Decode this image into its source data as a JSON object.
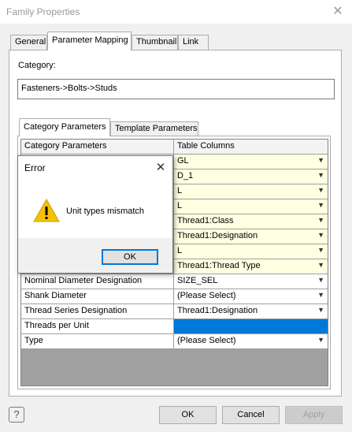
{
  "window": {
    "title": "Family Properties"
  },
  "tabs": [
    {
      "label": "General"
    },
    {
      "label": "Parameter Mapping"
    },
    {
      "label": "Thumbnail"
    },
    {
      "label": "Link"
    }
  ],
  "category": {
    "label": "Category:",
    "value": "Fasteners->Bolts->Studs"
  },
  "subtabs": [
    {
      "label": "Category Parameters"
    },
    {
      "label": "Template Parameters"
    }
  ],
  "grid": {
    "headers": [
      "Category Parameters",
      "Table Columns"
    ],
    "rows": [
      {
        "name": "",
        "column": "GL"
      },
      {
        "name": "",
        "column": "D_1"
      },
      {
        "name": "",
        "column": "L"
      },
      {
        "name": "",
        "column": "L"
      },
      {
        "name": "",
        "column": "Thread1:Class"
      },
      {
        "name": "",
        "column": "Thread1:Designation"
      },
      {
        "name": "",
        "column": "L"
      },
      {
        "name": "",
        "column": "Thread1:Thread Type"
      },
      {
        "name": "Nominal Diameter Designation",
        "column": "SIZE_SEL"
      },
      {
        "name": "Shank Diameter",
        "column": "(Please Select)"
      },
      {
        "name": "Thread Series Designation",
        "column": "Thread1:Designation"
      },
      {
        "name": "Threads per Unit",
        "column": ""
      },
      {
        "name": "Type",
        "column": "(Please Select)"
      }
    ]
  },
  "buttons": {
    "ok": "OK",
    "cancel": "Cancel",
    "apply": "Apply",
    "help": "?"
  },
  "dialog": {
    "title": "Error",
    "message": "Unit types mismatch",
    "ok": "OK"
  },
  "colors": {
    "accent": "#0078d7",
    "mapped_cell": "#ffffe1",
    "warning": "#f6c100"
  }
}
